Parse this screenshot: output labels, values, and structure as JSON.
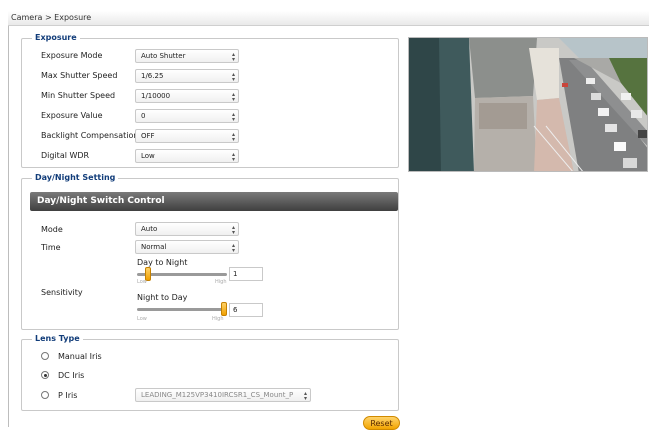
{
  "breadcrumb": "Camera > Exposure",
  "exposure": {
    "legend": "Exposure",
    "rows": [
      {
        "label": "Exposure Mode",
        "value": "Auto Shutter"
      },
      {
        "label": "Max Shutter Speed",
        "value": "1/6.25"
      },
      {
        "label": "Min Shutter Speed",
        "value": "1/10000"
      },
      {
        "label": "Exposure Value",
        "value": "0"
      },
      {
        "label": "Backlight Compensation",
        "value": "OFF"
      },
      {
        "label": "Digital WDR",
        "value": "Low"
      }
    ]
  },
  "day_night": {
    "legend": "Day/Night Setting",
    "header": "Day/Night Switch Control",
    "mode_label": "Mode",
    "mode_value": "Auto",
    "time_label": "Time",
    "time_value": "Normal",
    "sensitivity_label": "Sensitivity",
    "day_to_night": {
      "title": "Day to Night",
      "value": "1",
      "level": 0.1,
      "low": "Low",
      "high": "High"
    },
    "night_to_day": {
      "title": "Night to Day",
      "value": "6",
      "level": 1.0,
      "low": "Low",
      "high": "High"
    }
  },
  "lens": {
    "legend": "Lens Type",
    "options": [
      {
        "label": "Manual Iris",
        "selected": false
      },
      {
        "label": "DC Iris",
        "selected": true
      },
      {
        "label": "P Iris",
        "selected": false
      }
    ],
    "p_iris_value": "LEADING_M125VP3410IRCSR1_CS_Mount_P"
  },
  "reset_label": "Reset",
  "icons": {
    "select_caret": "updown-caret-icon",
    "preview": "camera-preview-image"
  }
}
